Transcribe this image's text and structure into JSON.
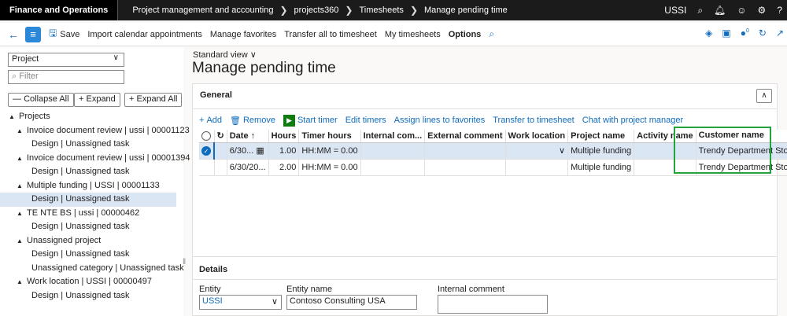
{
  "topbar": {
    "brand": "Finance and Operations",
    "breadcrumbs": [
      "Project management and accounting",
      "projects360",
      "Timesheets",
      "Manage pending time"
    ],
    "company": "USSI",
    "help": "?"
  },
  "actionbar": {
    "save": "Save",
    "import_calendar": "Import calendar appointments",
    "manage_favorites": "Manage favorites",
    "transfer_all": "Transfer all to timesheet",
    "my_timesheets": "My timesheets",
    "options": "Options",
    "notification_count": "0"
  },
  "leftpanel": {
    "select_value": "Project",
    "filter_placeholder": "Filter",
    "collapse_all": "Collapse All",
    "expand": "Expand",
    "expand_all": "Expand All",
    "tree": [
      {
        "label": "Projects",
        "level": 0,
        "arrow": true
      },
      {
        "label": "Invoice document review | ussi | 00001123",
        "level": 1,
        "arrow": true
      },
      {
        "label": "Design | Unassigned task",
        "level": 2,
        "arrow": false
      },
      {
        "label": "Invoice document review | ussi | 00001394",
        "level": 1,
        "arrow": true
      },
      {
        "label": "Design | Unassigned task",
        "level": 2,
        "arrow": false
      },
      {
        "label": "Multiple funding | USSI | 00001133",
        "level": 1,
        "arrow": true
      },
      {
        "label": "Design | Unassigned task",
        "level": 2,
        "arrow": false,
        "selected": true
      },
      {
        "label": "TE NTE BS | ussi | 00000462",
        "level": 1,
        "arrow": true
      },
      {
        "label": "Design | Unassigned task",
        "level": 2,
        "arrow": false
      },
      {
        "label": "Unassigned project",
        "level": 1,
        "arrow": true
      },
      {
        "label": "Design | Unassigned task",
        "level": 2,
        "arrow": false
      },
      {
        "label": "Unassigned category | Unassigned task",
        "level": 2,
        "arrow": false
      },
      {
        "label": "Work location | USSI | 00000497",
        "level": 1,
        "arrow": true
      },
      {
        "label": "Design | Unassigned task",
        "level": 2,
        "arrow": false
      }
    ]
  },
  "main": {
    "standard_view": "Standard view",
    "title": "Manage pending time",
    "general": {
      "title": "General",
      "toolbar": {
        "add": "Add",
        "remove": "Remove",
        "start_timer": "Start timer",
        "edit_timers": "Edit timers",
        "assign_favorites": "Assign lines to favorites",
        "transfer": "Transfer to timesheet",
        "chat": "Chat with project manager"
      },
      "columns": [
        "Date",
        "Hours",
        "Timer hours",
        "Internal com...",
        "External comment",
        "Work location",
        "Project name",
        "Activity name",
        "Customer name"
      ],
      "rows": [
        {
          "date": "6/30...",
          "hours": "1.00",
          "timer": "HH:MM = 0.00",
          "internal": "",
          "external": "",
          "work_location": "",
          "project": "Multiple funding",
          "activity": "",
          "customer": "Trendy Department Stores",
          "selected": true
        },
        {
          "date": "6/30/20...",
          "hours": "2.00",
          "timer": "HH:MM = 0.00",
          "internal": "",
          "external": "",
          "work_location": "",
          "project": "Multiple funding",
          "activity": "",
          "customer": "Trendy Department Stores",
          "selected": false
        }
      ]
    },
    "details": {
      "title": "Details",
      "entity_label": "Entity",
      "entity_value": "USSI",
      "entity_name_label": "Entity name",
      "entity_name_value": "Contoso Consulting USA",
      "internal_comment_label": "Internal comment"
    }
  }
}
